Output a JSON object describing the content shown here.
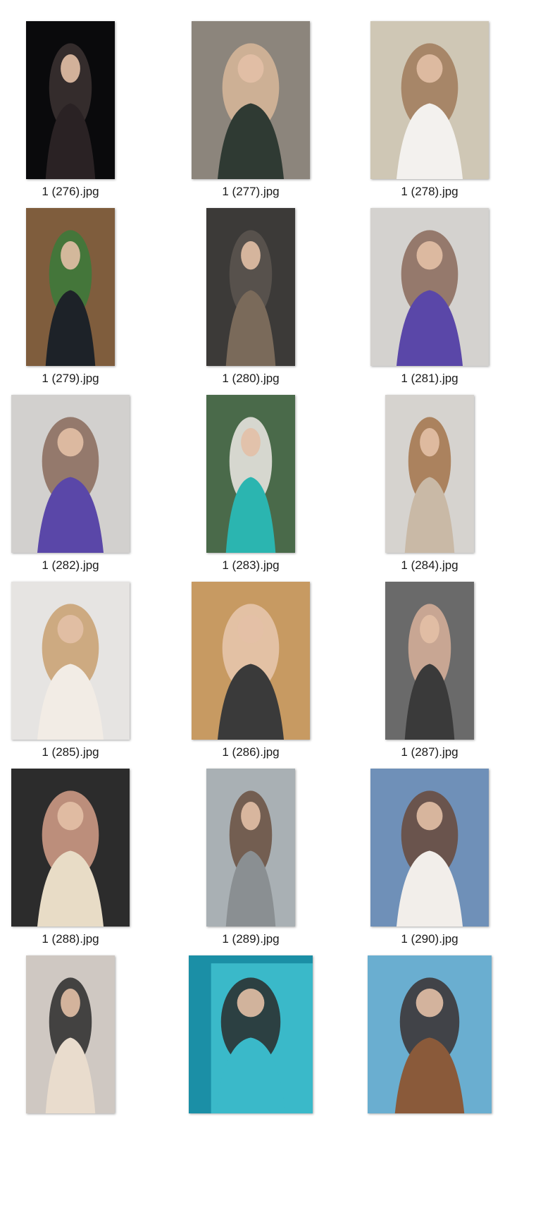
{
  "files": [
    {
      "name": "1 (276).jpg",
      "kind": "portrait",
      "colors": [
        "#0a0a0c",
        "#2a2224",
        "#3c3232"
      ]
    },
    {
      "name": "1 (277).jpg",
      "kind": "portrait",
      "colors": [
        "#8c857c",
        "#2f3a33",
        "#d8b79a"
      ]
    },
    {
      "name": "1 (278).jpg",
      "kind": "portrait",
      "colors": [
        "#cfc7b5",
        "#f3f1ee",
        "#a07a5a"
      ]
    },
    {
      "name": "1 (279).jpg",
      "kind": "portrait",
      "colors": [
        "#7f5d3d",
        "#1d2228",
        "#3a7a3a"
      ]
    },
    {
      "name": "1 (280).jpg",
      "kind": "portrait",
      "colors": [
        "#3c3a38",
        "#7a6a5a",
        "#5c5650"
      ]
    },
    {
      "name": "1 (281).jpg",
      "kind": "portrait",
      "colors": [
        "#d4d2cf",
        "#5a47a8",
        "#8a6a5a"
      ]
    },
    {
      "name": "1 (282).jpg",
      "kind": "portrait",
      "colors": [
        "#d2d0ce",
        "#5a47a8",
        "#8a6a5a"
      ]
    },
    {
      "name": "1 (283).jpg",
      "kind": "portrait",
      "colors": [
        "#4a6a4a",
        "#2bb5b0",
        "#eeeae6"
      ]
    },
    {
      "name": "1 (284).jpg",
      "kind": "portrait",
      "colors": [
        "#d6d3cf",
        "#c9b9a6",
        "#a3734a"
      ]
    },
    {
      "name": "1 (285).jpg",
      "kind": "portrait",
      "colors": [
        "#e6e4e2",
        "#f2ece5",
        "#c8a070"
      ]
    },
    {
      "name": "1 (286).jpg",
      "kind": "portrait",
      "colors": [
        "#c79a62",
        "#3a3a3a",
        "#e8c8b0"
      ]
    },
    {
      "name": "1 (287).jpg",
      "kind": "portrait",
      "colors": [
        "#6a6a6a",
        "#3a3a3a",
        "#d8b09a"
      ]
    },
    {
      "name": "1 (288).jpg",
      "kind": "portrait",
      "colors": [
        "#2c2c2c",
        "#e8dcc6",
        "#d6a08a"
      ]
    },
    {
      "name": "1 (289).jpg",
      "kind": "portrait",
      "colors": [
        "#a9b0b4",
        "#8a8f92",
        "#6a5040"
      ]
    },
    {
      "name": "1 (290).jpg",
      "kind": "portrait",
      "colors": [
        "#6f90b8",
        "#f2eeea",
        "#6a4a3a"
      ]
    },
    {
      "name": "",
      "kind": "portrait",
      "colors": [
        "#cfc8c2",
        "#e9dccd",
        "#2a2a2a"
      ]
    },
    {
      "name": "",
      "kind": "pool",
      "colors": [
        "#1b8fa6",
        "#3ab9c9",
        "#2a2a2a"
      ]
    },
    {
      "name": "",
      "kind": "portrait",
      "colors": [
        "#6aaed0",
        "#8a5a3a",
        "#3a3030"
      ]
    }
  ]
}
